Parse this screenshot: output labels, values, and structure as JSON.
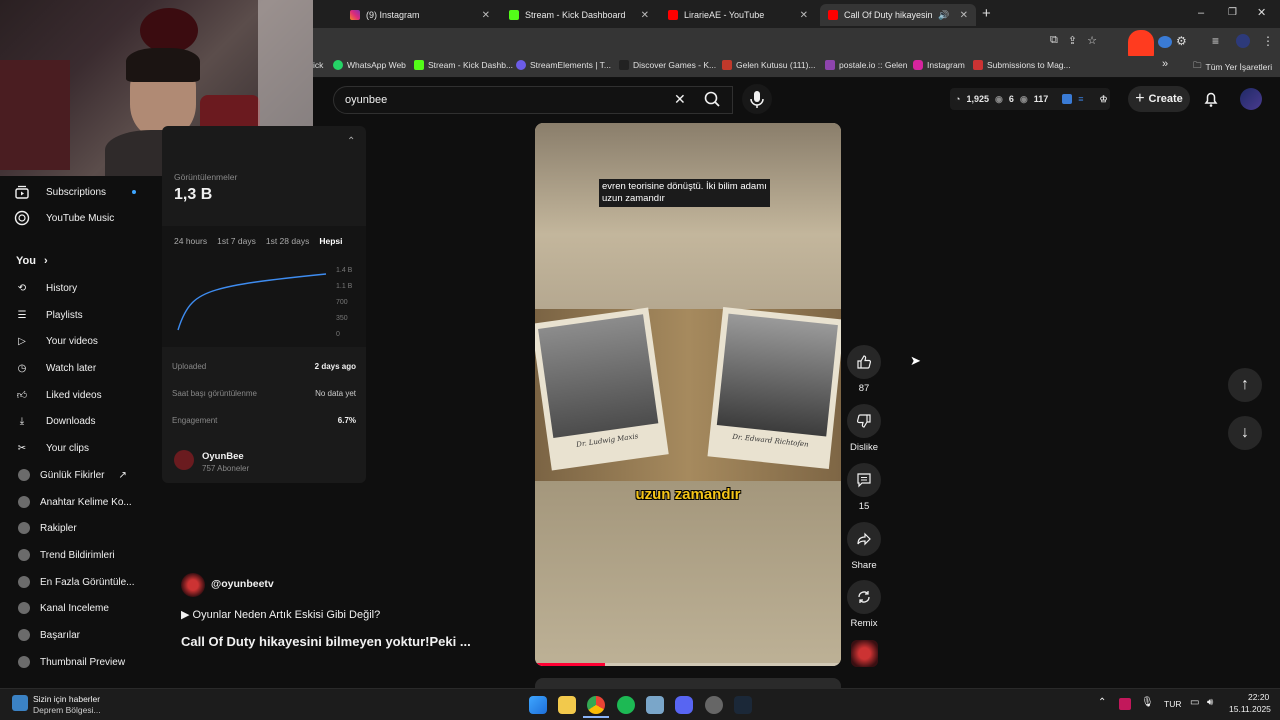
{
  "browser": {
    "tabs": [
      {
        "label": "(9) Instagram",
        "favcolor": "#d6249f"
      },
      {
        "label": "Stream - Kick Dashboard",
        "favcolor": "#53fc18"
      },
      {
        "label": "LirarieAE - YouTube",
        "favcolor": "#ff0000"
      },
      {
        "label": "Call Of Duty hikayesini bilme",
        "favcolor": "#ff0000"
      }
    ],
    "new_tab": "+",
    "bookmarks": [
      "ick",
      "WhatsApp Web",
      "Stream - Kick Dashb...",
      "StreamElements | T...",
      "Discover Games - K...",
      "Gelen Kutusu (111)...",
      "postale.io :: Gelen",
      "Instagram",
      "Submissions to Mag..."
    ],
    "more_bookmarks": "»",
    "all_bookmarks": "Tüm Yer İşaretleri"
  },
  "youtube": {
    "search_value": "oyunbee",
    "create_label": "Create",
    "stats": {
      "views": "1,925",
      "a": "6",
      "b": "117"
    },
    "sidebar": {
      "subscriptions": "Subscriptions",
      "music": "YouTube Music",
      "you": "You",
      "items": [
        "History",
        "Playlists",
        "Your videos",
        "Watch later",
        "Liked videos",
        "Downloads",
        "Your clips"
      ],
      "ext_items": [
        "Günlük Fikirler",
        "Anahtar Kelime Ko...",
        "Rakipler",
        "Trend Bildirimleri",
        "En Fazla Görüntüle...",
        "Kanal Inceleme",
        "Başarılar",
        "Thumbnail Preview"
      ]
    },
    "panel": {
      "views_label": "Görüntülenmeler",
      "views_value": "1,3 B",
      "ranges": [
        "24 hours",
        "1st 7 days",
        "1st 28 days",
        "Hepsi"
      ],
      "yticks": [
        "1.4 B",
        "1.1 B",
        "700",
        "350",
        "0"
      ],
      "rows": [
        {
          "k": "Uploaded",
          "v": "2 days ago"
        },
        {
          "k": "Saat başı görüntülenme",
          "v": "No data yet"
        },
        {
          "k": "Engagement",
          "v": "6.7%"
        }
      ],
      "channel_name": "OyunBee",
      "channel_subs": "757 Aboneler"
    },
    "video": {
      "caption_top_1": "evren teorisine dönüştü. İki bilim adamı",
      "caption_top_2": "uzun zamandır",
      "caption_mid": "uzun zamandır",
      "card_left": "Dr. Ludwig Maxis",
      "card_right": "Dr. Edward Richtofen",
      "progress": 0.23
    },
    "channel_handle": "@oyunbeetv",
    "playlist_link": "▶ Oyunlar Neden Artık Eskisi Gibi Değil?",
    "title": "Call Of Duty hikayesini bilmeyen yoktur!Peki ...",
    "actions": {
      "likes": "87",
      "dislike": "Dislike",
      "comments": "15",
      "share": "Share",
      "remix": "Remix"
    }
  },
  "taskbar": {
    "news_1": "Sizin için haberler",
    "news_2": "Deprem Bölgesi...",
    "lang": "TUR",
    "time": "22:20",
    "date": "15.11.2025"
  }
}
